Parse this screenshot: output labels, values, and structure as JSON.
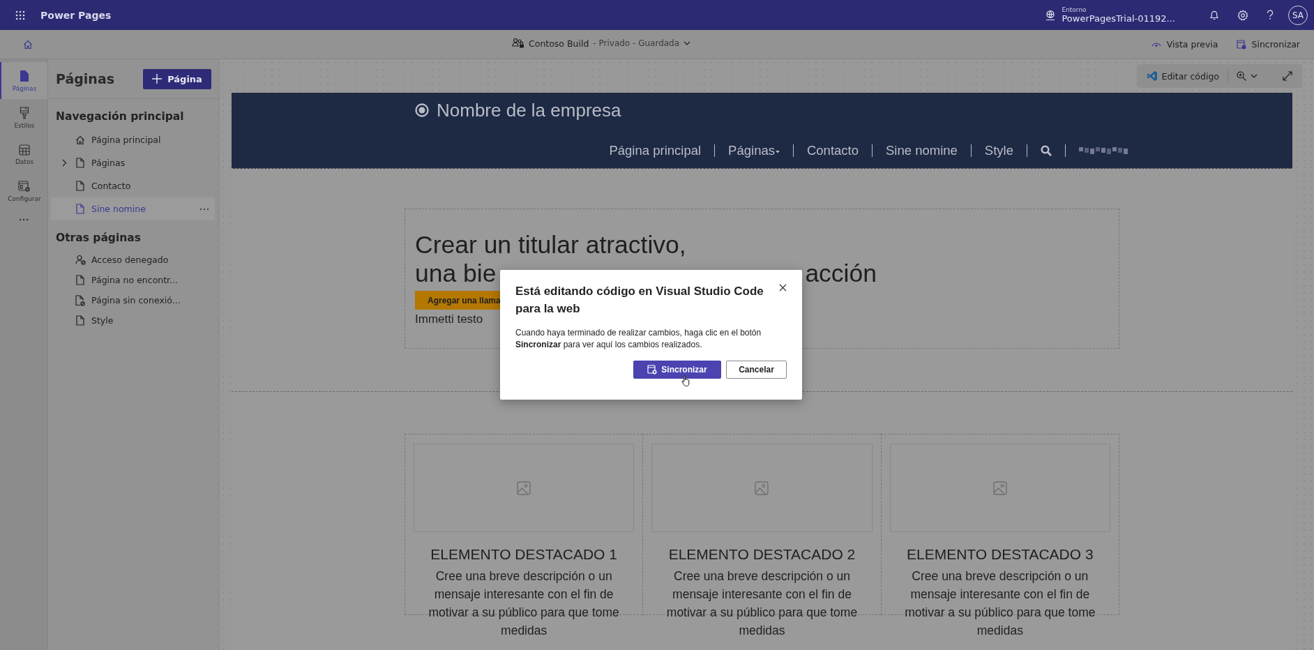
{
  "app_bar": {
    "title": "Power Pages",
    "environment_label": "Entorno",
    "environment_name": "PowerPagesTrial-01192...",
    "avatar": "SA"
  },
  "command_bar": {
    "site_name": "Contoso Build",
    "site_status": "- Privado - Guardada",
    "actions": [
      {
        "label": "Vista previa",
        "kind": "preview"
      },
      {
        "label": "Sincronizar",
        "kind": "sync"
      }
    ]
  },
  "rail": [
    {
      "label": "Páginas",
      "kind": "page",
      "selected": true
    },
    {
      "label": "Estilos",
      "kind": "brush",
      "selected": false
    },
    {
      "label": "Datos",
      "kind": "table",
      "selected": false
    },
    {
      "label": "Configurar",
      "kind": "config",
      "selected": false
    }
  ],
  "pages_panel": {
    "title": "Páginas",
    "add_button": "Página",
    "sections": [
      {
        "heading": "Navegación principal",
        "items": [
          {
            "label": "Página principal",
            "kind": "home",
            "selected": false,
            "expandable": false
          },
          {
            "label": "Páginas",
            "kind": "page",
            "selected": false,
            "expandable": true
          },
          {
            "label": "Contacto",
            "kind": "page",
            "selected": false,
            "expandable": false
          },
          {
            "label": "Sine nomine",
            "kind": "page",
            "selected": true,
            "expandable": false
          }
        ]
      },
      {
        "heading": "Otras páginas",
        "items": [
          {
            "label": "Acceso denegado",
            "kind": "person-block",
            "selected": false,
            "expandable": false
          },
          {
            "label": "Página no encontr...",
            "kind": "page",
            "selected": false,
            "expandable": false
          },
          {
            "label": "Página sin conexió...",
            "kind": "page-block",
            "selected": false,
            "expandable": false
          },
          {
            "label": "Style",
            "kind": "page",
            "selected": false,
            "expandable": false
          }
        ]
      }
    ]
  },
  "canvas_toolbar": {
    "edit_code": "Editar código"
  },
  "site": {
    "company": "Nombre de la empresa",
    "nav": [
      {
        "label": "Página principal",
        "dropdown": false
      },
      {
        "label": "Páginas",
        "dropdown": true
      },
      {
        "label": "Contacto",
        "dropdown": false
      },
      {
        "label": "Sine nomine",
        "dropdown": false
      },
      {
        "label": "Style",
        "dropdown": false
      }
    ],
    "hero": {
      "title_line1": "Crear un titular atractivo,",
      "title_line2_visible": [
        "una bie",
        "acción"
      ],
      "cta": "Agregar una llama",
      "text": "Immetti testo"
    },
    "features": [
      {
        "title": "ELEMENTO DESTACADO 1",
        "description": "Cree una breve descripción o un mensaje interesante con el fin de motivar a su público para que tome medidas"
      },
      {
        "title": "ELEMENTO DESTACADO 2",
        "description": "Cree una breve descripción o un mensaje interesante con el fin de motivar a su público para que tome medidas"
      },
      {
        "title": "ELEMENTO DESTACADO 3",
        "description": "Cree una breve descripción o un mensaje interesante con el fin de motivar a su público para que tome medidas"
      }
    ]
  },
  "dialog": {
    "title": "Está editando código en Visual Studio Code para la web",
    "body": "Cuando haya terminado de realizar cambios, haga clic en el botón **Sincronizar** para ver aquí los cambios realizados.",
    "primary": "Sincronizar",
    "secondary": "Cancelar"
  }
}
